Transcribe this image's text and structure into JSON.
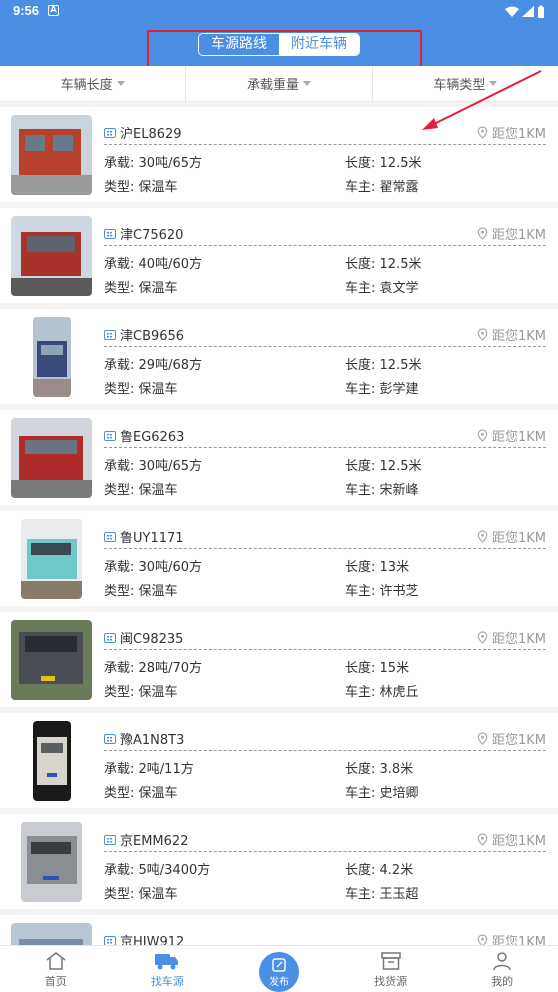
{
  "status_bar": {
    "time": "9:56",
    "notification_glyph": "A"
  },
  "segmented": {
    "tab1": "车源路线",
    "tab2": "附近车辆"
  },
  "filters": [
    "车辆长度",
    "承载重量",
    "车辆类型"
  ],
  "vehicles": [
    {
      "plate": "沪EL8629",
      "distance": "距您1KM",
      "load_label": "承载:",
      "load": "30吨/65方",
      "length_label": "长度:",
      "length": "12.5米",
      "type_label": "类型:",
      "type": "保温车",
      "owner_label": "车主:",
      "owner": "翟常露",
      "thumb_color": "#b8402e"
    },
    {
      "plate": "津C75620",
      "distance": "距您1KM",
      "load_label": "承载:",
      "load": "40吨/60方",
      "length_label": "长度:",
      "length": "12.5米",
      "type_label": "类型:",
      "type": "保温车",
      "owner_label": "车主:",
      "owner": "袁文学",
      "thumb_color": "#a8322c"
    },
    {
      "plate": "津CB9656",
      "distance": "距您1KM",
      "load_label": "承载:",
      "load": "29吨/68方",
      "length_label": "长度:",
      "length": "12.5米",
      "type_label": "类型:",
      "type": "保温车",
      "owner_label": "车主:",
      "owner": "彭学建",
      "thumb_color": "#3a4a7a"
    },
    {
      "plate": "鲁EG6263",
      "distance": "距您1KM",
      "load_label": "承载:",
      "load": "30吨/65方",
      "length_label": "长度:",
      "length": "12.5米",
      "type_label": "类型:",
      "type": "保温车",
      "owner_label": "车主:",
      "owner": "宋新峰",
      "thumb_color": "#b02c2c"
    },
    {
      "plate": "鲁UY1171",
      "distance": "距您1KM",
      "load_label": "承载:",
      "load": "30吨/60方",
      "length_label": "长度:",
      "length": "13米",
      "type_label": "类型:",
      "type": "保温车",
      "owner_label": "车主:",
      "owner": "许书芝",
      "thumb_color": "#6fc8c8"
    },
    {
      "plate": "闽C98235",
      "distance": "距您1KM",
      "load_label": "承载:",
      "load": "28吨/70方",
      "length_label": "长度:",
      "length": "15米",
      "type_label": "类型:",
      "type": "保温车",
      "owner_label": "车主:",
      "owner": "林虎丘",
      "thumb_color": "#4a4e54"
    },
    {
      "plate": "豫A1N8T3",
      "distance": "距您1KM",
      "load_label": "承载:",
      "load": "2吨/11方",
      "length_label": "长度:",
      "length": "3.8米",
      "type_label": "类型:",
      "type": "保温车",
      "owner_label": "车主:",
      "owner": "史培卿",
      "thumb_color": "#d9d5cc"
    },
    {
      "plate": "京EMM622",
      "distance": "距您1KM",
      "load_label": "承载:",
      "load": "5吨/3400方",
      "length_label": "长度:",
      "length": "4.2米",
      "type_label": "类型:",
      "type": "保温车",
      "owner_label": "车主:",
      "owner": "王玉超",
      "thumb_color": "#8a8e92"
    },
    {
      "plate": "京HJW912",
      "distance": "距您1KM",
      "thumb_color": "#7a8ea8"
    }
  ],
  "bottom_nav": {
    "home": "首页",
    "find_vehicle": "找车源",
    "publish": "发布",
    "find_cargo": "找货源",
    "mine": "我的"
  },
  "colors": {
    "primary": "#4a8fe3",
    "annotation": "#e0203a"
  }
}
